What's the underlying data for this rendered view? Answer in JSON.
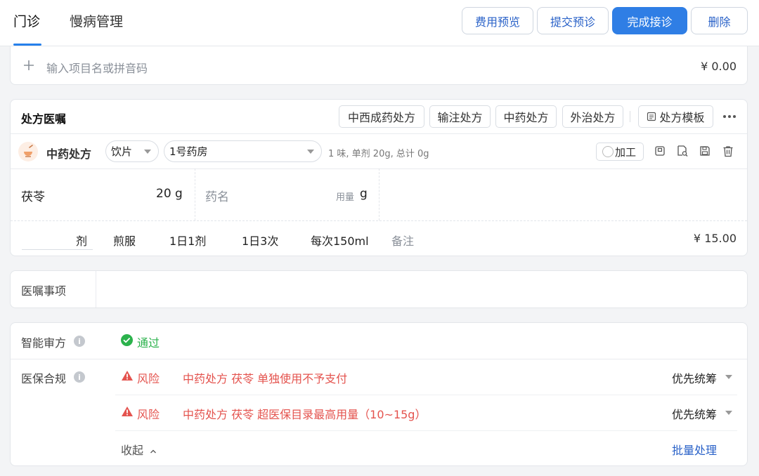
{
  "tabs": [
    {
      "label": "门诊"
    },
    {
      "label": "慢病管理"
    }
  ],
  "top_actions": {
    "fee_preview": "费用预览",
    "submit_pre": "提交预诊",
    "finish": "完成接诊",
    "delete": "删除"
  },
  "add_item": {
    "placeholder": "输入项目名或拼音码",
    "total": "¥ 0.00"
  },
  "prescription": {
    "title": "处方医嘱",
    "types": [
      "中西成药处方",
      "输注处方",
      "中药处方",
      "外治处方"
    ],
    "template_label": "处方模板",
    "tcm": {
      "title": "中药处方",
      "form": "饮片",
      "pharmacy": "1号药房",
      "summary": "1 味, 单剂 20g, 总计 0g",
      "process_label": "加工",
      "herb_name": "茯苓",
      "herb_dose": "20 g",
      "new_herb_placeholder": "药名",
      "new_herb_dose_label": "用量",
      "new_herb_unit": "g",
      "dose_unit": "剂",
      "usage": "煎服",
      "freq_day": "1日1剂",
      "freq_times": "1日3次",
      "per_dose": "每次150ml",
      "note_placeholder": "备注",
      "price": "¥ 15.00"
    }
  },
  "advice": {
    "label": "医嘱事项"
  },
  "review": {
    "smart_label": "智能审方",
    "smart_status": "通过",
    "insurance_label": "医保合规",
    "risks": [
      {
        "level": "风险",
        "message": "中药处方 茯苓 单独使用不予支付",
        "action": "优先统筹"
      },
      {
        "level": "风险",
        "message": "中药处方 茯苓 超医保目录最高用量（10~15g）",
        "action": "优先统筹"
      }
    ],
    "collapse_label": "收起",
    "batch_label": "批量处理"
  },
  "colors": {
    "primary": "#2f7ee5",
    "danger": "#e4534e",
    "success": "#2bb24c"
  }
}
